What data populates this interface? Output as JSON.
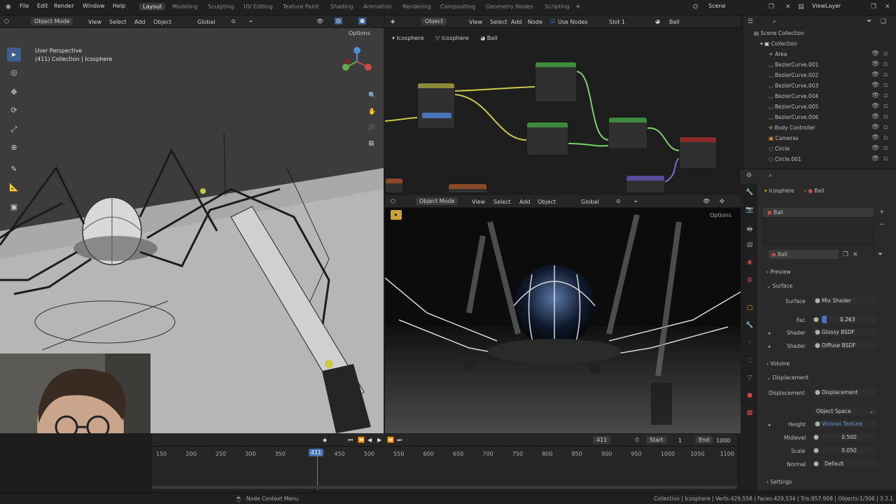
{
  "topbar": {
    "menus": [
      "File",
      "Edit",
      "Render",
      "Window",
      "Help"
    ],
    "workspaces": [
      "Layout",
      "Modeling",
      "Sculpting",
      "UV Editing",
      "Texture Paint",
      "Shading",
      "Animation",
      "Rendering",
      "Compositing",
      "Geometry Nodes",
      "Scripting"
    ],
    "active_workspace": "Layout",
    "scene": "Scene",
    "view_layer": "ViewLayer"
  },
  "viewport": {
    "mode": "Object Mode",
    "menus": [
      "View",
      "Select",
      "Add",
      "Object"
    ],
    "orientation": "Global",
    "options": "Options",
    "title": "User Perspective",
    "subtitle": "(411) Collection | Icosphere"
  },
  "node_editor": {
    "mode": "Object",
    "menus": [
      "View",
      "Select",
      "Add",
      "Node"
    ],
    "use_nodes": "Use Nodes",
    "slot": "Slot 1",
    "material": "Ball",
    "breadcrumb": [
      "Icosphere",
      "Icosphere",
      "Ball"
    ]
  },
  "render_view": {
    "mode": "Object Mode",
    "menus": [
      "View",
      "Select",
      "Add",
      "Object"
    ],
    "orientation": "Global",
    "options": "Options"
  },
  "timeline": {
    "current_frame": "411",
    "current_display": "411",
    "start_label": "Start",
    "start": "1",
    "end_label": "End",
    "end": "1000",
    "ticks": [
      "150",
      "200",
      "250",
      "300",
      "350",
      "411",
      "450",
      "500",
      "550",
      "600",
      "650",
      "700",
      "750",
      "800",
      "850",
      "900",
      "950",
      "1000",
      "1050",
      "1100"
    ]
  },
  "outliner": {
    "root": "Scene Collection",
    "collection": "Collection",
    "items": [
      "Area",
      "BezierCurve.001",
      "BezierCurve.002",
      "BezierCurve.003",
      "BezierCurve.004",
      "BezierCurve.005",
      "BezierCurve.006",
      "Body Controller",
      "Cameras",
      "Circle",
      "Circle.001"
    ]
  },
  "properties": {
    "breadcrumb": [
      "Icosphere",
      "Ball"
    ],
    "slot_name": "Ball",
    "material_name": "Ball",
    "sections": {
      "preview": "Preview",
      "surface": "Surface",
      "volume": "Volume",
      "displacement": "Displacement",
      "settings": "Settings"
    },
    "surface_label": "Surface",
    "surface_value": "Mix Shader",
    "fac_label": "Fac",
    "fac_value": "0.263",
    "shader1_label": "Shader",
    "shader1_value": "Glossy BSDF",
    "shader2_label": "Shader",
    "shader2_value": "Diffuse BSDF",
    "displacement_label": "Displacement",
    "displacement_value": "Displacement",
    "space_value": "Object Space",
    "height_label": "Height",
    "height_value": "Voronoi Texture",
    "midlevel_label": "Midlevel",
    "midlevel_value": "0.500",
    "scale_label": "Scale",
    "scale_value": "0.050",
    "normal_label": "Normal",
    "normal_value": "Default"
  },
  "statusbar": {
    "hint": "Node Context Menu",
    "stats": "Collection | Icosphere | Verts:429,558 | Faces:429,534 | Tris:857,908 | Objects:1/306 | 3.2.1"
  },
  "colors": {
    "accent": "#4772b3",
    "frame": "#5680c2",
    "bg": "#1d1d1d"
  }
}
